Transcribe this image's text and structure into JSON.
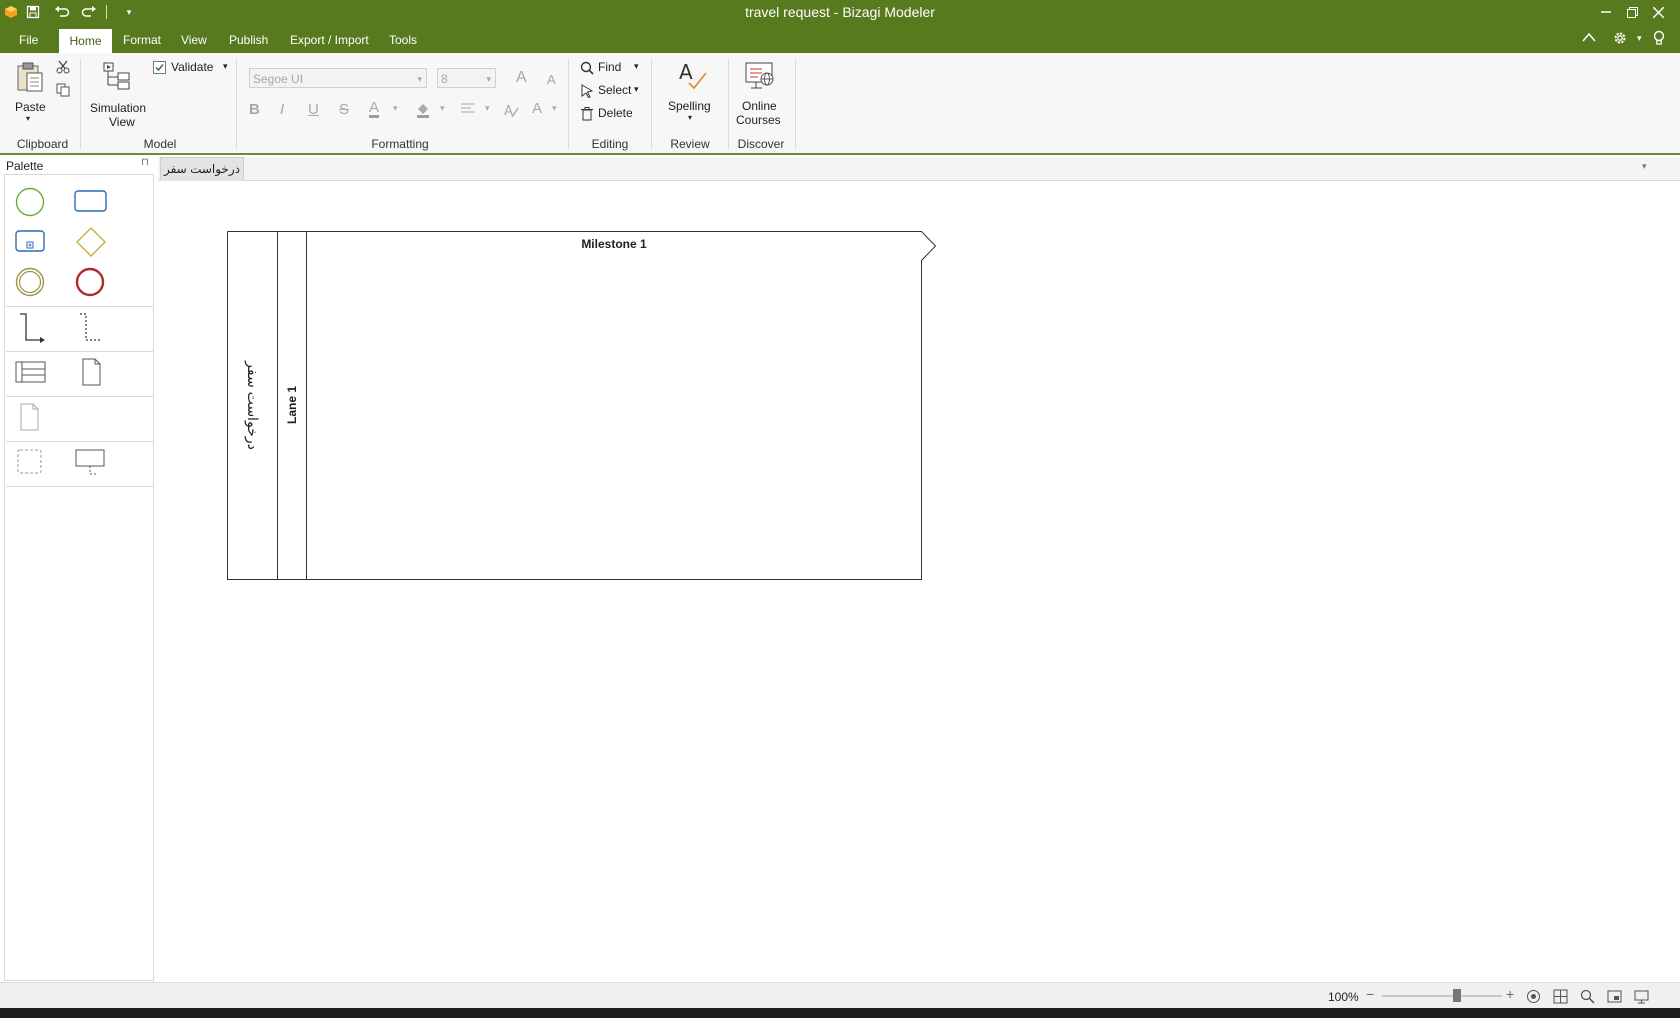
{
  "window": {
    "title": "travel request - Bizagi Modeler",
    "controls": [
      "minimize",
      "restore",
      "close"
    ]
  },
  "menu_tabs": [
    "File",
    "Home",
    "Format",
    "View",
    "Publish",
    "Export / Import",
    "Tools"
  ],
  "active_tab": "Home",
  "ribbon": {
    "clipboard": {
      "paste": "Paste",
      "group": "Clipboard"
    },
    "model": {
      "simulation_line1": "Simulation",
      "simulation_line2": "View",
      "validate": "Validate",
      "group": "Model"
    },
    "formatting": {
      "font": "Segoe UI",
      "size": "8",
      "group": "Formatting"
    },
    "editing": {
      "find": "Find",
      "select": "Select",
      "delete": "Delete",
      "group": "Editing"
    },
    "review": {
      "spelling": "Spelling",
      "group": "Review"
    },
    "discover": {
      "courses_line1": "Online",
      "courses_line2": "Courses",
      "group": "Discover"
    }
  },
  "palette": {
    "title": "Palette",
    "pin_icon": "pin-icon",
    "shapes": [
      "start-event",
      "task",
      "sub-process",
      "gateway",
      "intermediate-event",
      "end-event",
      "sequence-flow",
      "association",
      "pool",
      "data-object",
      "artifact",
      "group",
      "annotation"
    ]
  },
  "document_tab": "درخواست سفر",
  "diagram": {
    "pool_name": "درخواست سفر",
    "lane_name": "Lane 1",
    "milestone_name": "Milestone 1"
  },
  "statusbar": {
    "zoom": "100%",
    "zoom_level": 100
  },
  "colors": {
    "accent": "#577a1e",
    "start_event": "#6aaa3a",
    "task": "#2e6db4",
    "gateway": "#c8b22d",
    "intermediate": "#9a9548",
    "end_event": "#b02a2a"
  }
}
